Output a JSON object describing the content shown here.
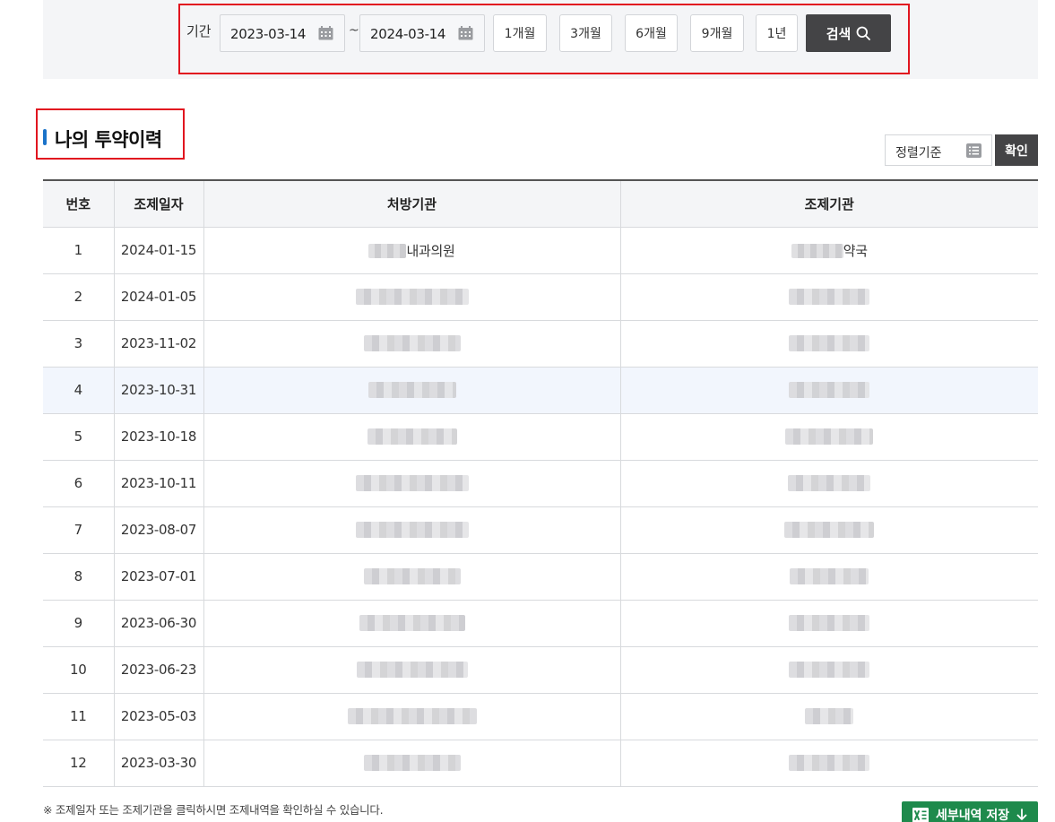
{
  "search": {
    "period_label": "기간",
    "start_date": "2023-03-14",
    "end_date": "2024-03-14",
    "separator": "~",
    "period_buttons": [
      "1개월",
      "3개월",
      "6개월",
      "9개월",
      "1년"
    ],
    "search_label": "검색"
  },
  "section": {
    "title": "나의 투약이력"
  },
  "sort": {
    "label": "정렬기준",
    "confirm_label": "확인"
  },
  "table": {
    "headers": [
      "번호",
      "조제일자",
      "처방기관",
      "조제기관"
    ],
    "rows": [
      {
        "no": "1",
        "date": "2024-01-15",
        "prescriber": "내과의원",
        "pharmacy": "약국"
      },
      {
        "no": "2",
        "date": "2024-01-05",
        "prescriber": "",
        "pharmacy": ""
      },
      {
        "no": "3",
        "date": "2023-11-02",
        "prescriber": "",
        "pharmacy": ""
      },
      {
        "no": "4",
        "date": "2023-10-31",
        "prescriber": "",
        "pharmacy": ""
      },
      {
        "no": "5",
        "date": "2023-10-18",
        "prescriber": "",
        "pharmacy": ""
      },
      {
        "no": "6",
        "date": "2023-10-11",
        "prescriber": "",
        "pharmacy": ""
      },
      {
        "no": "7",
        "date": "2023-08-07",
        "prescriber": "",
        "pharmacy": ""
      },
      {
        "no": "8",
        "date": "2023-07-01",
        "prescriber": "",
        "pharmacy": ""
      },
      {
        "no": "9",
        "date": "2023-06-30",
        "prescriber": "",
        "pharmacy": ""
      },
      {
        "no": "10",
        "date": "2023-06-23",
        "prescriber": "",
        "pharmacy": ""
      },
      {
        "no": "11",
        "date": "2023-05-03",
        "prescriber": "",
        "pharmacy": ""
      },
      {
        "no": "12",
        "date": "2023-03-30",
        "prescriber": "",
        "pharmacy": ""
      }
    ]
  },
  "footer": {
    "note": "※ 조제일자 또는 조제기관을 클릭하시면 조제내역을 확인하실 수 있습니다.",
    "excel_label": "세부내역 저장"
  },
  "colors": {
    "accent_blue": "#1a73c9",
    "highlight_frame": "#e1151f",
    "dark_button": "#444446",
    "excel_green": "#1e8a4c"
  }
}
